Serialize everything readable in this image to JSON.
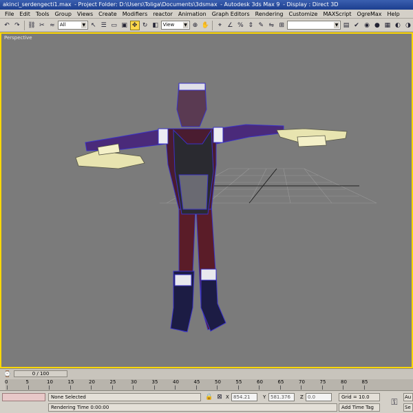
{
  "titlebar": {
    "file": "akinci_serdengecti1.max",
    "project": "- Project Folder: D:\\Users\\Toliga\\Documents\\3dsmax",
    "app": "- Autodesk 3ds Max 9",
    "display": "- Display : Direct 3D"
  },
  "menu": [
    "File",
    "Edit",
    "Tools",
    "Group",
    "Views",
    "Create",
    "Modifiers",
    "reactor",
    "Animation",
    "Graph Editors",
    "Rendering",
    "Customize",
    "MAXScript",
    "OgreMax",
    "Help"
  ],
  "toolbar": {
    "filter_value": "All",
    "refcoord_value": "View"
  },
  "viewport": {
    "label": "Perspective"
  },
  "timeline": {
    "slider_text": "0 / 100",
    "ticks": [
      "0",
      "5",
      "10",
      "15",
      "20",
      "25",
      "30",
      "35",
      "40",
      "45",
      "50",
      "55",
      "60",
      "65",
      "70",
      "75",
      "80",
      "85"
    ]
  },
  "status": {
    "selection": "None Selected",
    "render_time": "Rendering Time 0:00:00",
    "x_label": "X",
    "x_value": "854.21",
    "y_label": "Y",
    "y_value": "581.376",
    "z_label": "Z",
    "z_value": "0.0",
    "grid": "Grid = 10.0",
    "add_time_tag": "Add Time Tag",
    "auto_label": "Au",
    "set_label": "Se"
  },
  "colors": {
    "viewport_bg": "#7b7b7b",
    "active_border": "#ffd800",
    "wire": "#3a32c8"
  }
}
